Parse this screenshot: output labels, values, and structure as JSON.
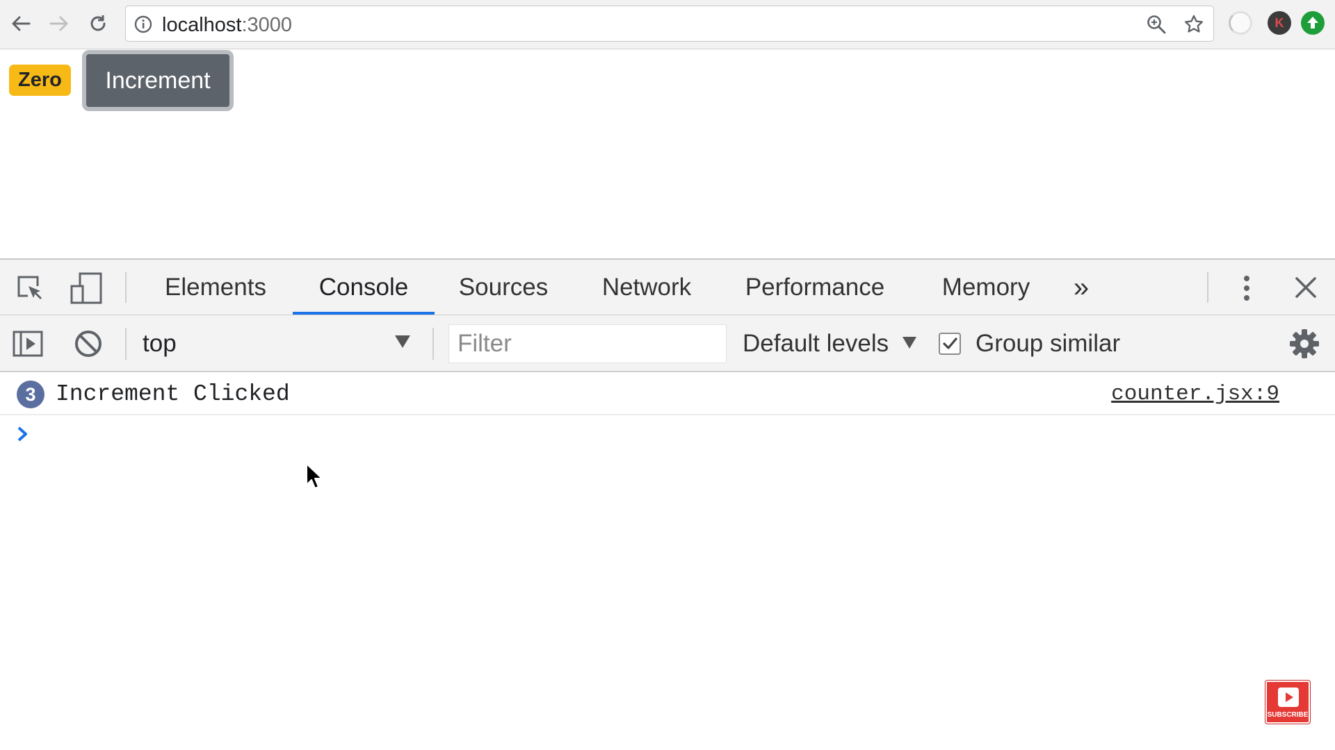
{
  "browser": {
    "url_host": "localhost",
    "url_port": ":3000",
    "icons": {
      "back": "back-arrow-icon",
      "forward": "forward-arrow-icon",
      "reload": "reload-icon",
      "info": "info-icon",
      "zoom": "zoom-icon",
      "bookmark": "star-icon",
      "extension_loading": "loading-extension-icon",
      "extension_k": "k-extension-icon",
      "extension_up": "upload-extension-icon"
    },
    "extension_k_letter": "K"
  },
  "page": {
    "badge_label": "Zero",
    "button_label": "Increment",
    "colors": {
      "badge": "#f7b916",
      "button": "#5c636a"
    }
  },
  "devtools": {
    "tabs": [
      {
        "label": "Elements",
        "active": false
      },
      {
        "label": "Console",
        "active": true
      },
      {
        "label": "Sources",
        "active": false
      },
      {
        "label": "Network",
        "active": false
      },
      {
        "label": "Performance",
        "active": false
      },
      {
        "label": "Memory",
        "active": false
      }
    ],
    "more_tabs_glyph": "»",
    "icons": {
      "inspect": "inspect-element-icon",
      "device": "device-toolbar-icon",
      "more": "kebab-menu-icon",
      "close": "close-icon",
      "sidebar": "console-sidebar-icon",
      "clear": "clear-console-icon",
      "settings": "gear-icon"
    },
    "console_bar": {
      "context": "top",
      "filter_placeholder": "Filter",
      "levels_label": "Default levels",
      "group_similar_label": "Group similar",
      "group_similar_checked": true
    },
    "log": {
      "repeat_count": "3",
      "message": "Increment Clicked",
      "source": "counter.jsx:9"
    },
    "accent_color": "#1a73e8"
  },
  "overlay": {
    "subscribe_label": "SUBSCRIBE"
  }
}
